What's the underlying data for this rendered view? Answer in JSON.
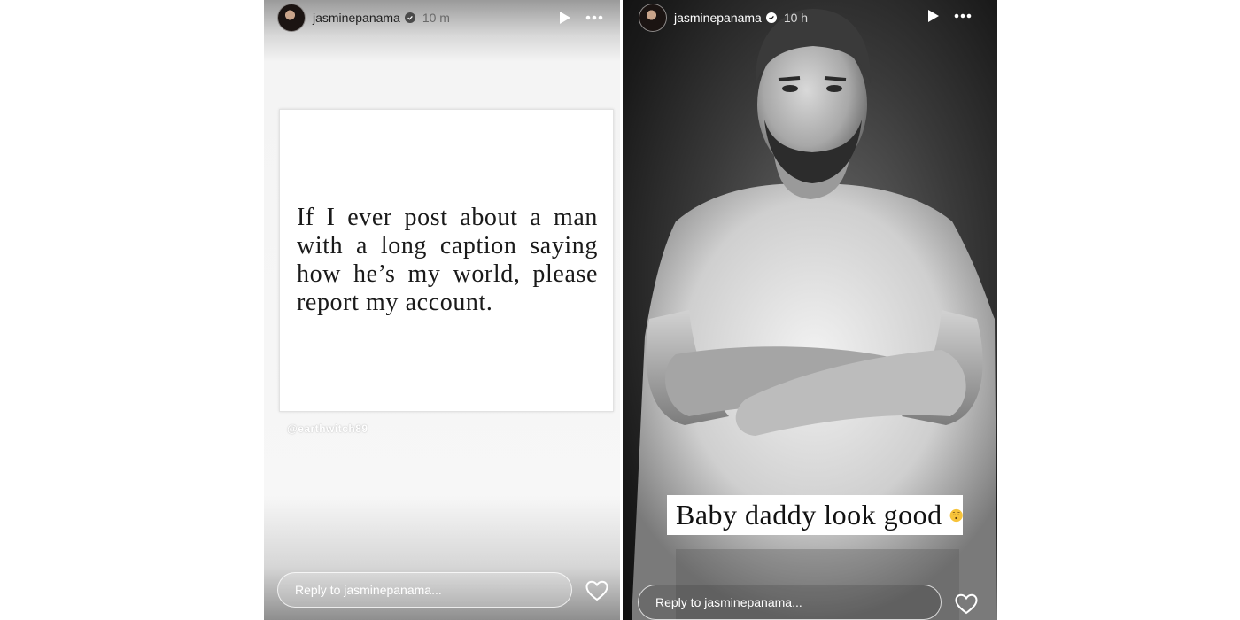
{
  "stories": [
    {
      "username": "jasminepanama",
      "timestamp": "10 m",
      "card_text": "If I ever post about a man with a long caption saying how he’s my world, please report my account.",
      "watermark": "@earthwitch89",
      "reply_placeholder": "Reply to jasminepanama..."
    },
    {
      "username": "jasminepanama",
      "timestamp": "10 h",
      "caption": "Baby daddy look good",
      "caption_emoji": "face-with-rolling-sweat-emoji",
      "reply_placeholder": "Reply to jasminepanama..."
    }
  ],
  "icons": {
    "avatar": "profile-avatar",
    "verified": "verified-badge-icon",
    "play": "play-icon",
    "more": "more-options-icon",
    "like": "heart-icon"
  }
}
